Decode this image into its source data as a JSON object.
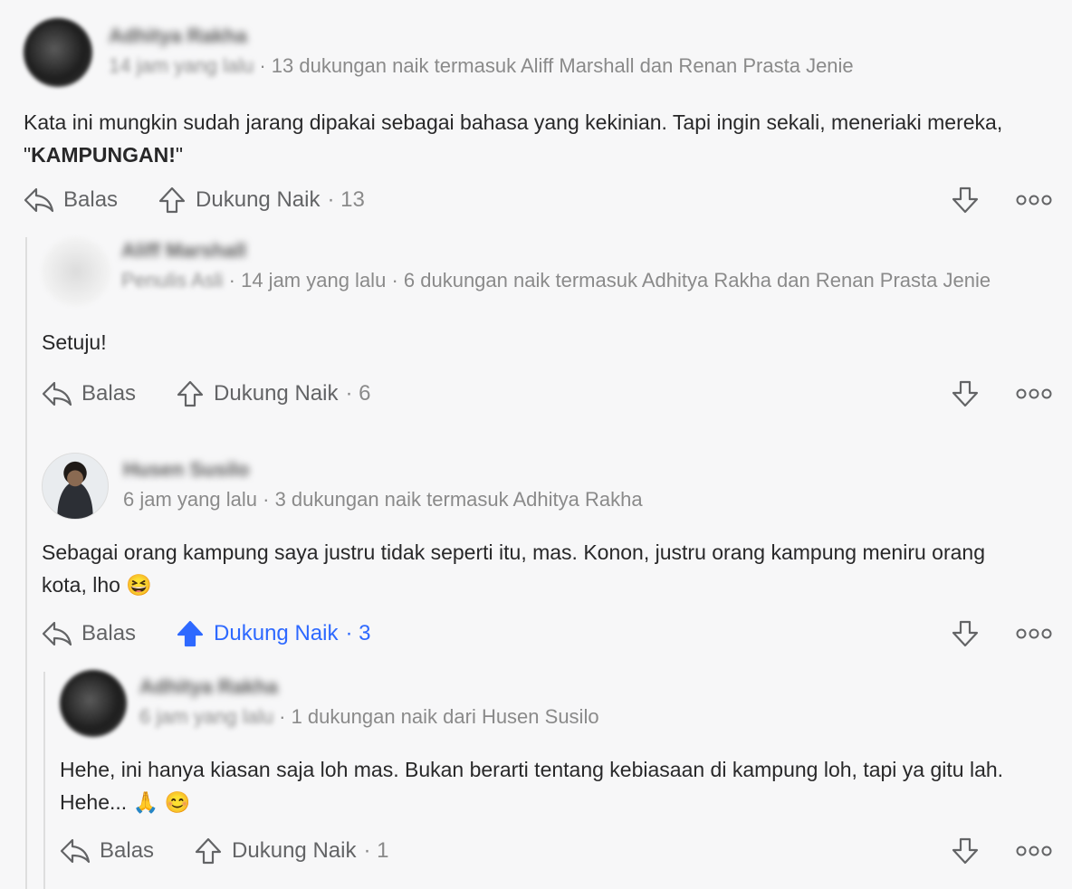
{
  "comments": [
    {
      "author": "Adhitya Rakha",
      "time": "14 jam yang lalu",
      "upvote_info": "13 dukungan naik termasuk Aliff Marshall dan Renan Prasta Jenie",
      "text_before": "Kata ini mungkin sudah jarang dipakai sebagai bahasa yang kekinian. Tapi ingin sekali, meneriaki mereka, \"",
      "text_bold": "KAMPUNGAN!",
      "text_after": "\"",
      "reply_label": "Balas",
      "upvote_label": "Dukung Naik",
      "upvote_count": "13"
    },
    {
      "author": "Aliff Marshall",
      "role": "Penulis Asli",
      "time": "14 jam yang lalu",
      "upvote_info": "6 dukungan naik termasuk Adhitya Rakha dan Renan Prasta Jenie",
      "text": "Setuju!",
      "reply_label": "Balas",
      "upvote_label": "Dukung Naik",
      "upvote_count": "6"
    },
    {
      "author": "Husen Susilo",
      "time": "6 jam yang lalu",
      "upvote_info": "3 dukungan naik termasuk Adhitya Rakha",
      "text": "Sebagai orang kampung saya justru tidak seperti itu, mas. Konon, justru orang kampung meniru orang kota, lho 😆",
      "reply_label": "Balas",
      "upvote_label": "Dukung Naik",
      "upvote_count": "3"
    },
    {
      "author": "Adhitya Rakha",
      "time": "6 jam yang lalu",
      "upvote_info": "1 dukungan naik dari Husen Susilo",
      "text": "Hehe, ini hanya kiasan saja loh mas. Bukan berarti tentang kebiasaan di kampung loh, tapi ya gitu lah. Hehe... 🙏 😊",
      "reply_label": "Balas",
      "upvote_label": "Dukung Naik",
      "upvote_count": "1"
    }
  ],
  "separator": "·",
  "icons": {
    "reply": "reply-arrow-icon",
    "upvote": "upvote-arrow-icon",
    "downvote": "downvote-arrow-icon",
    "more": "more-options-icon"
  },
  "colors": {
    "accent": "#2e69ff",
    "text": "#282829",
    "muted": "#8a8a8a",
    "background": "#f7f7f8"
  }
}
